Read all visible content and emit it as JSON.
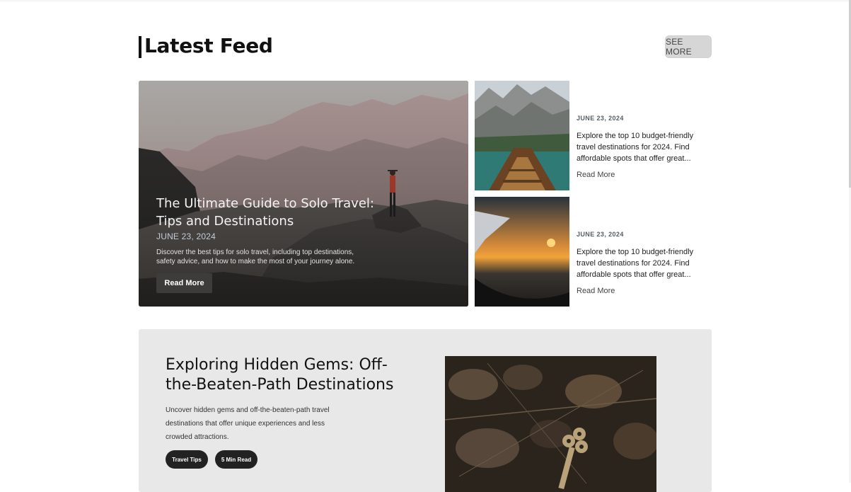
{
  "section": {
    "title": "Latest Feed",
    "see_more_label": "SEE MORE"
  },
  "hero": {
    "title": "The Ultimate Guide to Solo Travel: Tips and Destinations",
    "date": "JUNE 23, 2024",
    "description": "Discover the best tips for solo travel, including top destinations, safety advice, and how to make the most of your journey alone.",
    "button_label": "Read More"
  },
  "side_posts": [
    {
      "date": "JUNE 23, 2024",
      "description": "Explore the top 10 budget-friendly travel destinations for 2024. Find affordable spots that offer great...",
      "link_label": "Read More"
    },
    {
      "date": "JUNE 23, 2024",
      "description": "Explore the top 10 budget-friendly travel destinations for 2024. Find affordable spots that offer great...",
      "link_label": "Read More"
    }
  ],
  "feature": {
    "title": "Exploring Hidden Gems: Off-the-Beaten-Path Destinations",
    "description": "Uncover hidden gems and off-the-beaten-path travel destinations that offer unique experiences and less crowded attractions.",
    "tags": [
      "Travel Tips",
      "5 Min Read"
    ]
  }
}
